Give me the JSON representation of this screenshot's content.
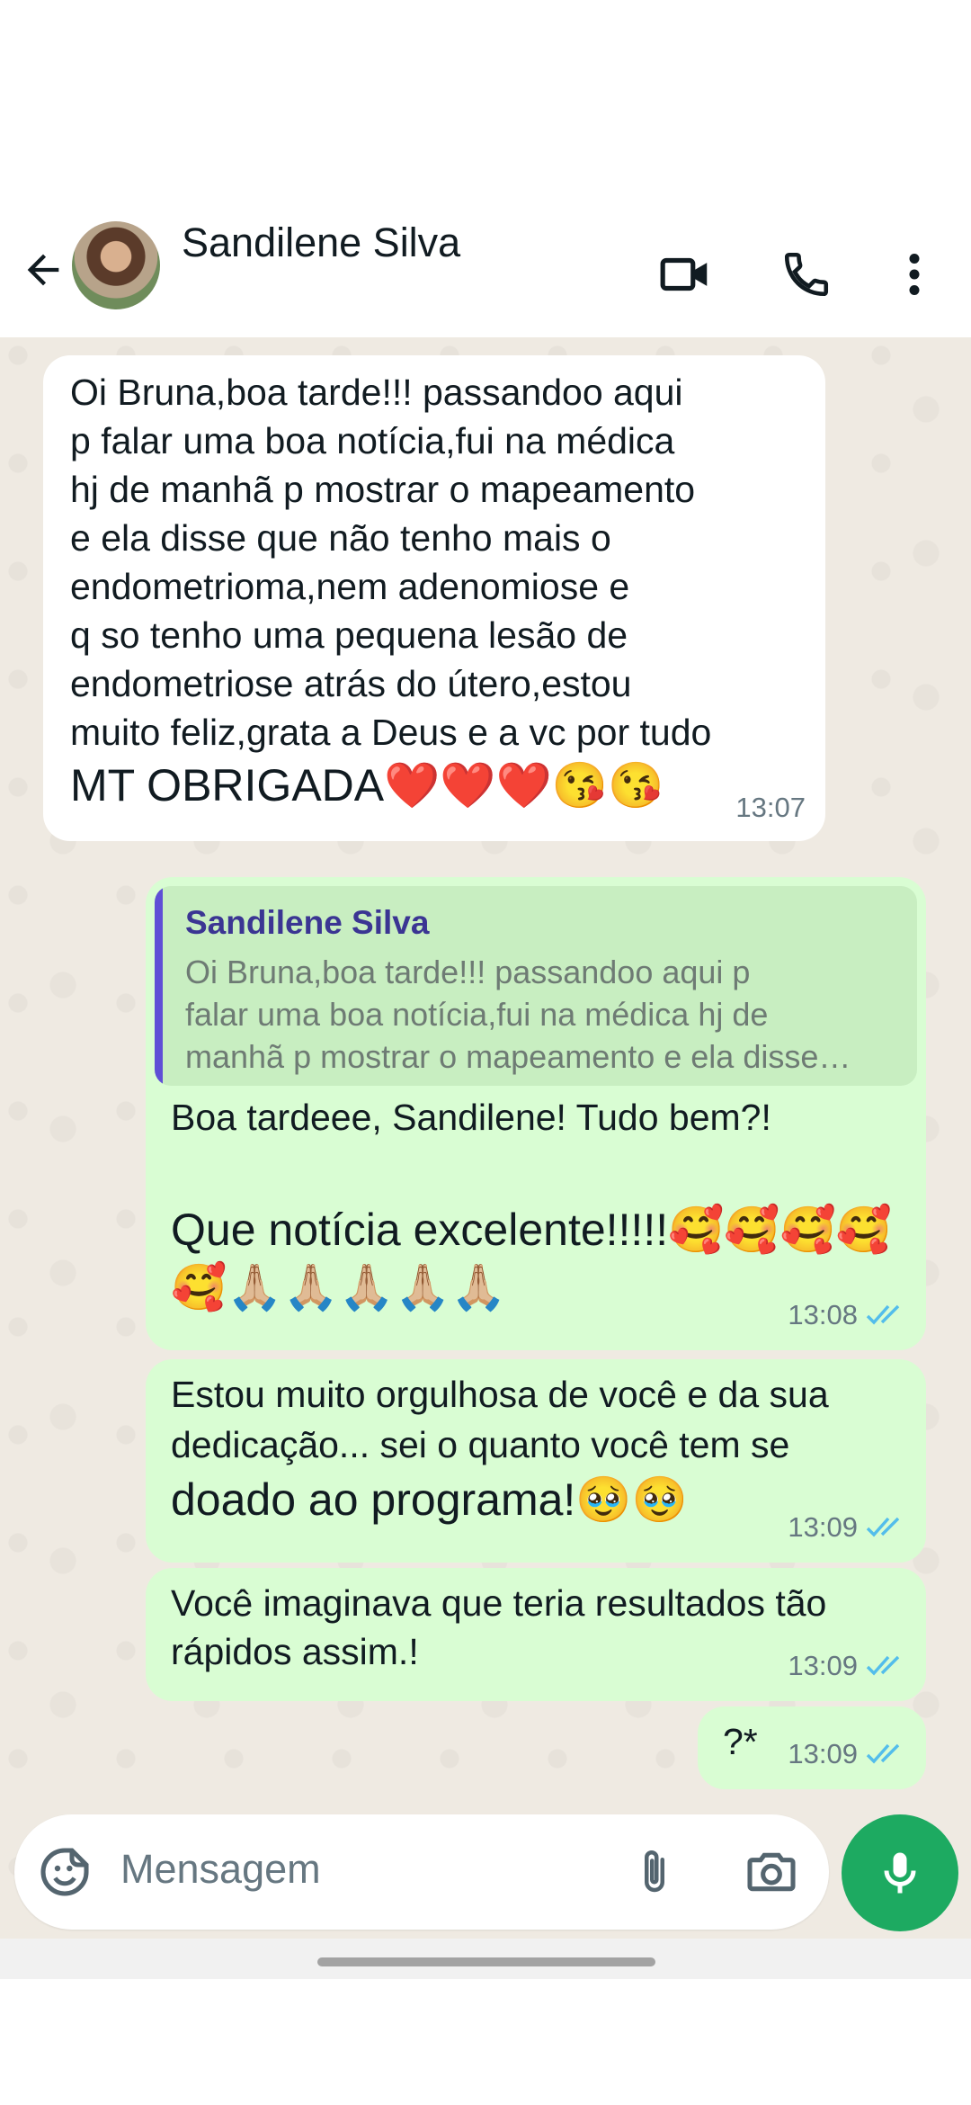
{
  "header": {
    "back_icon": "arrow-left-icon",
    "contact_name": "Sandilene Silva",
    "video_icon": "video-camera-icon",
    "call_icon": "phone-icon",
    "menu_icon": "more-vertical-icon"
  },
  "messages": [
    {
      "direction": "incoming",
      "lines": [
        "Oi Bruna,boa tarde!!! passandoo aqui",
        "p falar uma boa notícia,fui na médica",
        "hj de manhã p mostrar o mapeamento",
        "e ela disse que não tenho mais o",
        "endometrioma,nem adenomiose e",
        "q so tenho uma pequena lesão de",
        "endometriose atrás do útero,estou",
        "muito feliz,grata a Deus e a vc por tudo",
        "MT OBRIGADA❤️❤️❤️😘😘"
      ],
      "time": "13:07"
    },
    {
      "direction": "outgoing",
      "quote": {
        "name": "Sandilene Silva",
        "lines": [
          "Oi Bruna,boa tarde!!! passandoo aqui p",
          "falar uma boa notícia,fui na médica hj de",
          "manhã p mostrar o mapeamento e ela disse…"
        ]
      },
      "lines": [
        "Boa tardeee, Sandilene! Tudo bem?!",
        "",
        "Que notícia excelente!!!!!🥰🥰🥰🥰",
        "🥰🙏🏼🙏🏼🙏🏼🙏🏼🙏🏼"
      ],
      "time": "13:08",
      "status": "read"
    },
    {
      "direction": "outgoing",
      "lines": [
        "Estou muito orgulhosa de você e da sua",
        "dedicação... sei o quanto você tem se",
        "doado ao programa!🥹🥹"
      ],
      "time": "13:09",
      "status": "read"
    },
    {
      "direction": "outgoing",
      "lines": [
        "Você imaginava que teria resultados tão",
        "rápidos assim.!"
      ],
      "time": "13:09",
      "status": "read"
    },
    {
      "direction": "outgoing",
      "lines": [
        "?*"
      ],
      "time": "13:09",
      "status": "read"
    }
  ],
  "composer": {
    "placeholder": "Mensagem",
    "sticker_icon": "sticker-icon",
    "attach_icon": "paperclip-icon",
    "camera_icon": "camera-icon",
    "mic_icon": "microphone-icon"
  },
  "colors": {
    "outgoing_bubble": "#d9fdd3",
    "incoming_bubble": "#ffffff",
    "chat_background": "#efeae2",
    "read_ticks": "#53bdeb",
    "mic_button": "#1daa61"
  }
}
